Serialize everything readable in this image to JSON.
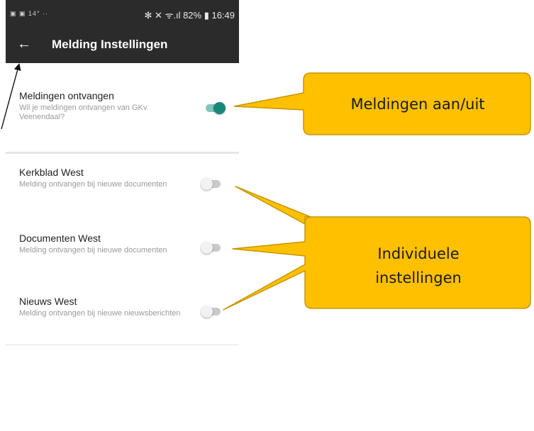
{
  "statusbar": {
    "left_icons": "▣ ▣ 14° ··",
    "right": "✻ ✕ ᯤ.ıl 82% ▮ 16:49"
  },
  "appbar": {
    "back_icon": "←",
    "title": "Melding Instellingen"
  },
  "settings": [
    {
      "title": "Meldingen ontvangen",
      "description": "Wil je meldingen ontvangen van GKv Veenendaal?",
      "enabled": true
    },
    {
      "title": "Kerkblad West",
      "description": "Melding ontvangen bij nieuwe documenten",
      "enabled": false
    },
    {
      "title": "Documenten West",
      "description": "Melding ontvangen bij nieuwe documenten",
      "enabled": false
    },
    {
      "title": "Nieuws West",
      "description": "Melding ontvangen bij nieuwe nieuwsberichten",
      "enabled": false
    }
  ],
  "callouts": {
    "main_toggle": "Meldingen aan/uit",
    "individual": "Individuele instellingen"
  },
  "colors": {
    "appbar": "#2b2b2b",
    "toggle_on": "#17877a",
    "callout_fill": "#ffc000",
    "callout_border": "#c79500"
  }
}
